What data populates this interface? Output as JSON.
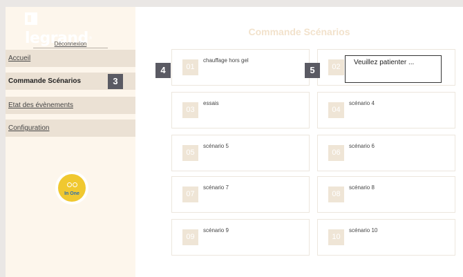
{
  "brand": {
    "logo_text": "legrand",
    "logo_reg": "®",
    "logout_label": "Déconnexion"
  },
  "sidebar": {
    "items": [
      {
        "label": "Accueil",
        "active": false
      },
      {
        "label": "Commande Scénarios",
        "active": true
      },
      {
        "label": "Etat des évènements",
        "active": false
      },
      {
        "label": "Configuration",
        "active": false
      }
    ],
    "badge": "3"
  },
  "inone_logo": {
    "text": "In One"
  },
  "main": {
    "title": "Commande Scénarios",
    "badges": [
      "4",
      "5"
    ],
    "scenarios": [
      {
        "num": "01",
        "name": "chauffage hors gel"
      },
      {
        "num": "02",
        "name": ""
      },
      {
        "num": "03",
        "name": "essais"
      },
      {
        "num": "04",
        "name": "scénario 4"
      },
      {
        "num": "05",
        "name": "scénario 5"
      },
      {
        "num": "06",
        "name": "scénario 6"
      },
      {
        "num": "07",
        "name": "scénario 7"
      },
      {
        "num": "08",
        "name": "scénario 8"
      },
      {
        "num": "09",
        "name": "scénario 9"
      },
      {
        "num": "10",
        "name": "scénario 10"
      }
    ],
    "wait_message": "Veuillez patienter ..."
  },
  "colors": {
    "sidebar_bg": "#fdf6ec",
    "nav_bg": "#ebe1d4",
    "badge": "#5a5a63",
    "number_tile": "#efe5d6",
    "title": "#f2e2cc"
  }
}
